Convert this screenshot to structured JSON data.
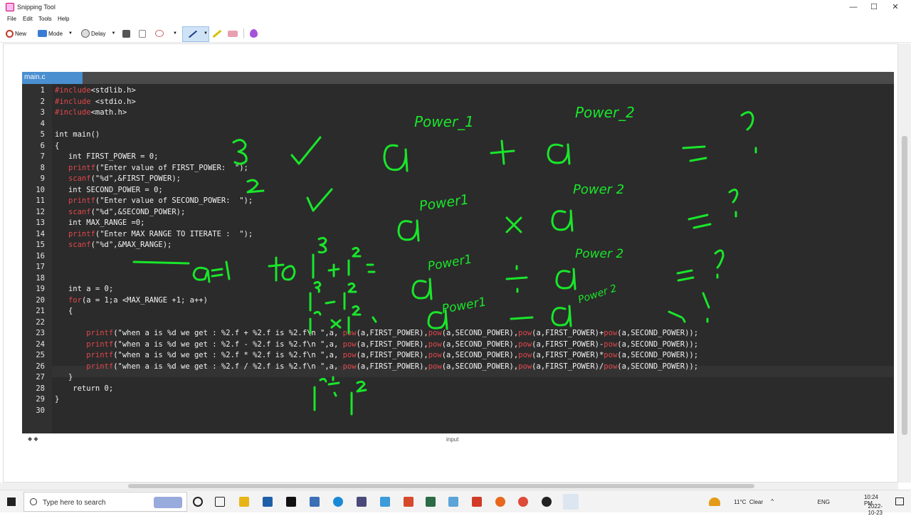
{
  "window": {
    "title": "Snipping Tool",
    "menu": [
      "File",
      "Edit",
      "Tools",
      "Help"
    ],
    "controls": [
      "—",
      "☐",
      "✕"
    ]
  },
  "toolbar": {
    "new_label": "New",
    "mode_label": "Mode",
    "delay_label": "Delay"
  },
  "editor": {
    "tab": "main.c",
    "line_numbers": [
      "1",
      "2",
      "3",
      "4",
      "5",
      "6",
      "7",
      "8",
      "9",
      "10",
      "11",
      "12",
      "13",
      "14",
      "15",
      "16",
      "17",
      "18",
      "19",
      "20",
      "21",
      "22",
      "23",
      "24",
      "25",
      "26",
      "27",
      "28",
      "29",
      "30"
    ],
    "code_lines": [
      "#include<stdlib.h>",
      "#include <stdio.h>",
      "#include<math.h>",
      "",
      "int main()",
      "{",
      "   int FIRST_POWER = 0;",
      "   printf(\"Enter value of FIRST_POWER:  \");",
      "   scanf(\"%d\",&FIRST_POWER);",
      "   int SECOND_POWER = 0;",
      "   printf(\"Enter value of SECOND_POWER:  \");",
      "   scanf(\"%d\",&SECOND_POWER);",
      "   int MAX_RANGE =0;",
      "   printf(\"Enter MAX RANGE TO ITERATE :  \");",
      "   scanf(\"%d\",&MAX_RANGE);",
      "",
      "",
      "",
      "   int a = 0;",
      "   for(a = 1;a <MAX_RANGE +1; a++)",
      "   {",
      "",
      "       printf(\"when a is %d we get : %2.f + %2.f is %2.f\\n \",a, pow(a,FIRST_POWER),pow(a,SECOND_POWER),pow(a,FIRST_POWER)+pow(a,SECOND_POWER));",
      "       printf(\"when a is %d we get : %2.f - %2.f is %2.f\\n \",a, pow(a,FIRST_POWER),pow(a,SECOND_POWER),pow(a,FIRST_POWER)-pow(a,SECOND_POWER));",
      "       printf(\"when a is %d we get : %2.f * %2.f is %2.f\\n \",a, pow(a,FIRST_POWER),pow(a,SECOND_POWER),pow(a,FIRST_POWER)*pow(a,SECOND_POWER));",
      "       printf(\"when a is %d we get : %2.f / %2.f is %2.f\\n \",a, pow(a,FIRST_POWER),pow(a,SECOND_POWER),pow(a,FIRST_POWER)/pow(a,SECOND_POWER));",
      "   }",
      "    return 0;",
      "}",
      ""
    ],
    "bottom_label": "input"
  },
  "annotations": [
    "Power_1",
    "Power_2",
    "?",
    "3",
    "2",
    "a=1",
    "to",
    "Power1",
    "Power 2",
    "Power1",
    "Power 2",
    "Power1",
    "Power 2"
  ],
  "taskbar": {
    "search_placeholder": "Type here to search",
    "weather": "11°C  Clear",
    "language": "ENG",
    "time": "10:24 PM",
    "date": "2022-10-23"
  },
  "colors": {
    "editor_bg": "#2b2b2b",
    "tab_active": "#4a8fd0",
    "keyword_red": "#e0474c",
    "ink_green": "#19e62a"
  }
}
